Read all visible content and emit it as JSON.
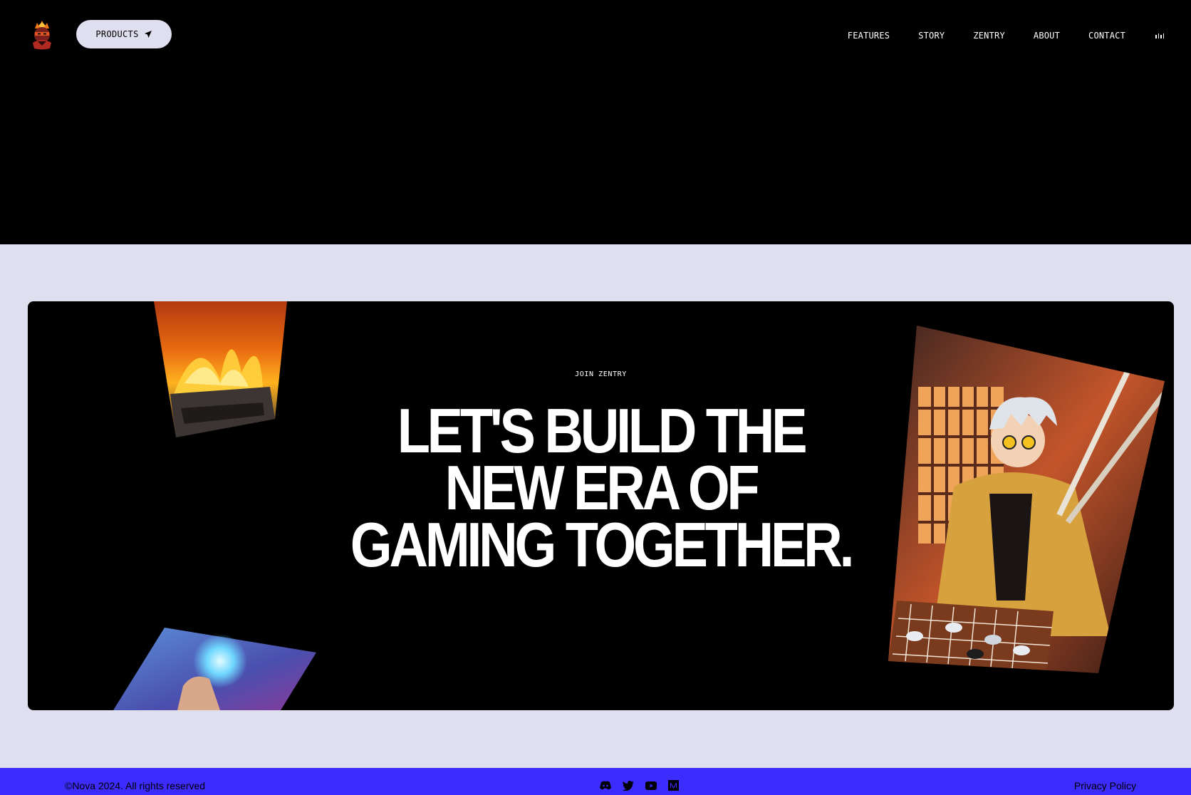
{
  "header": {
    "logo_icon": "ninja-logo-icon",
    "products_button": {
      "label": "PRODUCTS",
      "icon": "paper-plane-icon"
    },
    "nav_items": [
      {
        "label": "FEATURES"
      },
      {
        "label": "STORY"
      },
      {
        "label": "ZENTRY"
      },
      {
        "label": "ABOUT"
      },
      {
        "label": "CONTACT"
      }
    ],
    "audio_icon": "audio-bars-icon"
  },
  "join_section": {
    "eyebrow": "JOIN ZENTRY",
    "headline_lines": [
      "LET'S BUILD THE",
      "NEW ERA OF",
      "GAMING TOGETHER."
    ],
    "images": [
      "fire-forge-image",
      "glowing-orb-hand-image",
      "samurai-go-board-image"
    ]
  },
  "footer": {
    "copyright": "©Nova 2024. All rights reserved",
    "socials": [
      "discord-icon",
      "twitter-icon",
      "youtube-icon",
      "medium-icon"
    ],
    "privacy_label": "Privacy Policy"
  },
  "colors": {
    "background": "#000000",
    "lavender": "#dfdff0",
    "footer_blue": "#3c2cff",
    "text_light": "#ffffff"
  }
}
